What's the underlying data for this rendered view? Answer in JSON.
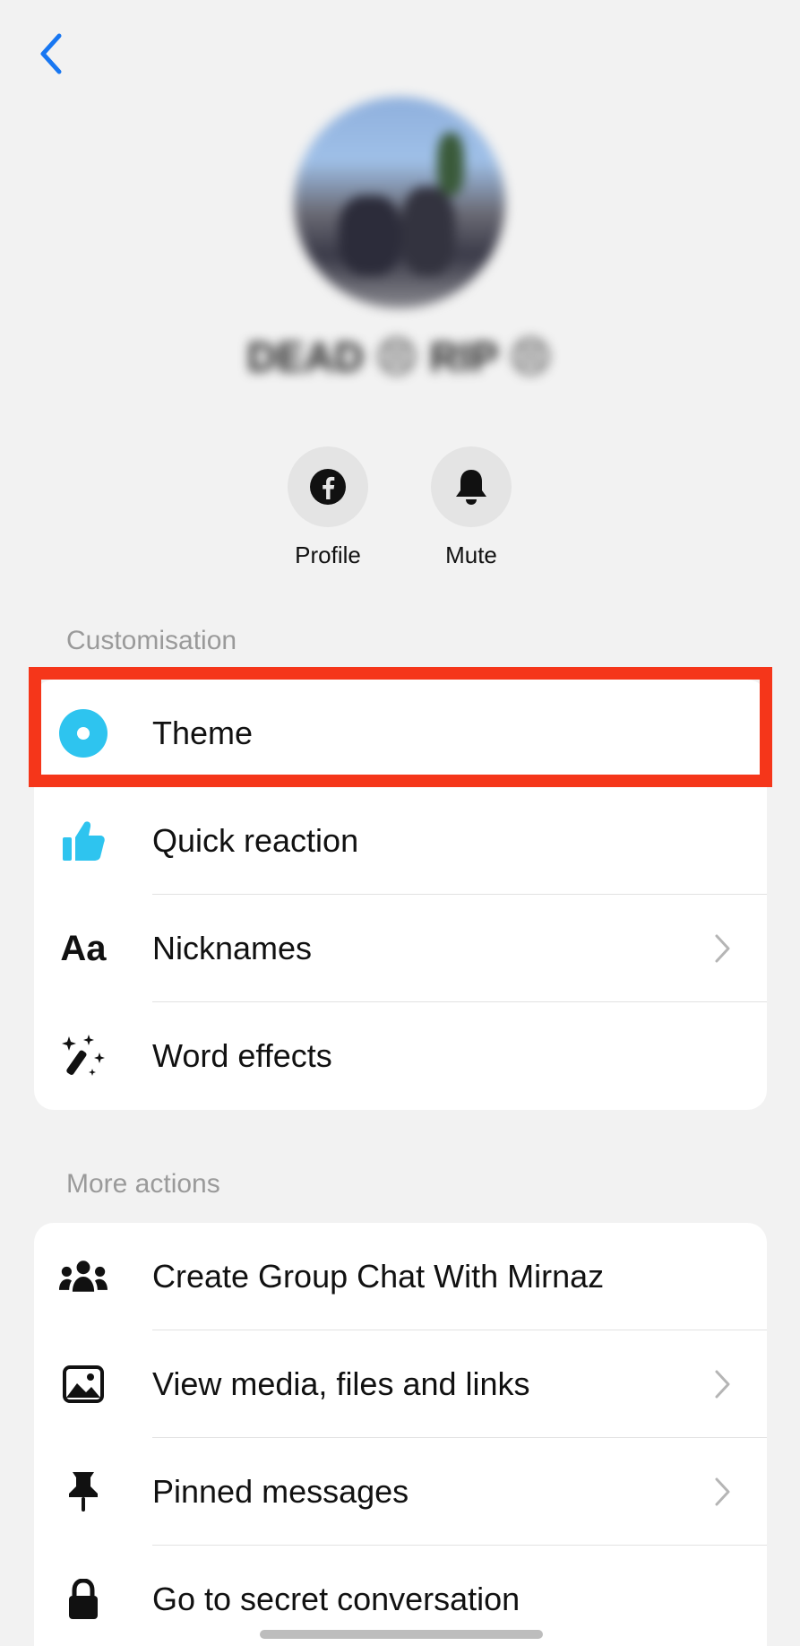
{
  "header": {
    "back_icon": "chevron-left-icon",
    "accent_color": "#1877f2"
  },
  "profile": {
    "name": "DEAD 😣 RIP 😣"
  },
  "actions": [
    {
      "label": "Profile",
      "icon": "facebook-icon"
    },
    {
      "label": "Mute",
      "icon": "bell-icon"
    }
  ],
  "customisation": {
    "title": "Customisation",
    "items": [
      {
        "label": "Theme",
        "icon": "theme-dot-icon",
        "chevron": false,
        "highlighted": true
      },
      {
        "label": "Quick reaction",
        "icon": "thumbs-up-icon",
        "chevron": false
      },
      {
        "label": "Nicknames",
        "icon": "text-aa-icon",
        "icon_text": "Aa",
        "chevron": true
      },
      {
        "label": "Word effects",
        "icon": "magic-wand-icon",
        "chevron": false
      }
    ]
  },
  "more_actions": {
    "title": "More actions",
    "items": [
      {
        "label": "Create Group Chat With Mirnaz",
        "icon": "people-icon",
        "chevron": false
      },
      {
        "label": "View media, files and links",
        "icon": "image-icon",
        "chevron": true
      },
      {
        "label": "Pinned messages",
        "icon": "pin-icon",
        "chevron": true
      },
      {
        "label": "Go to secret conversation",
        "icon": "lock-icon",
        "chevron": false
      }
    ]
  },
  "colors": {
    "theme_icon": "#2ec4ef",
    "highlight_border": "#f5361a"
  }
}
